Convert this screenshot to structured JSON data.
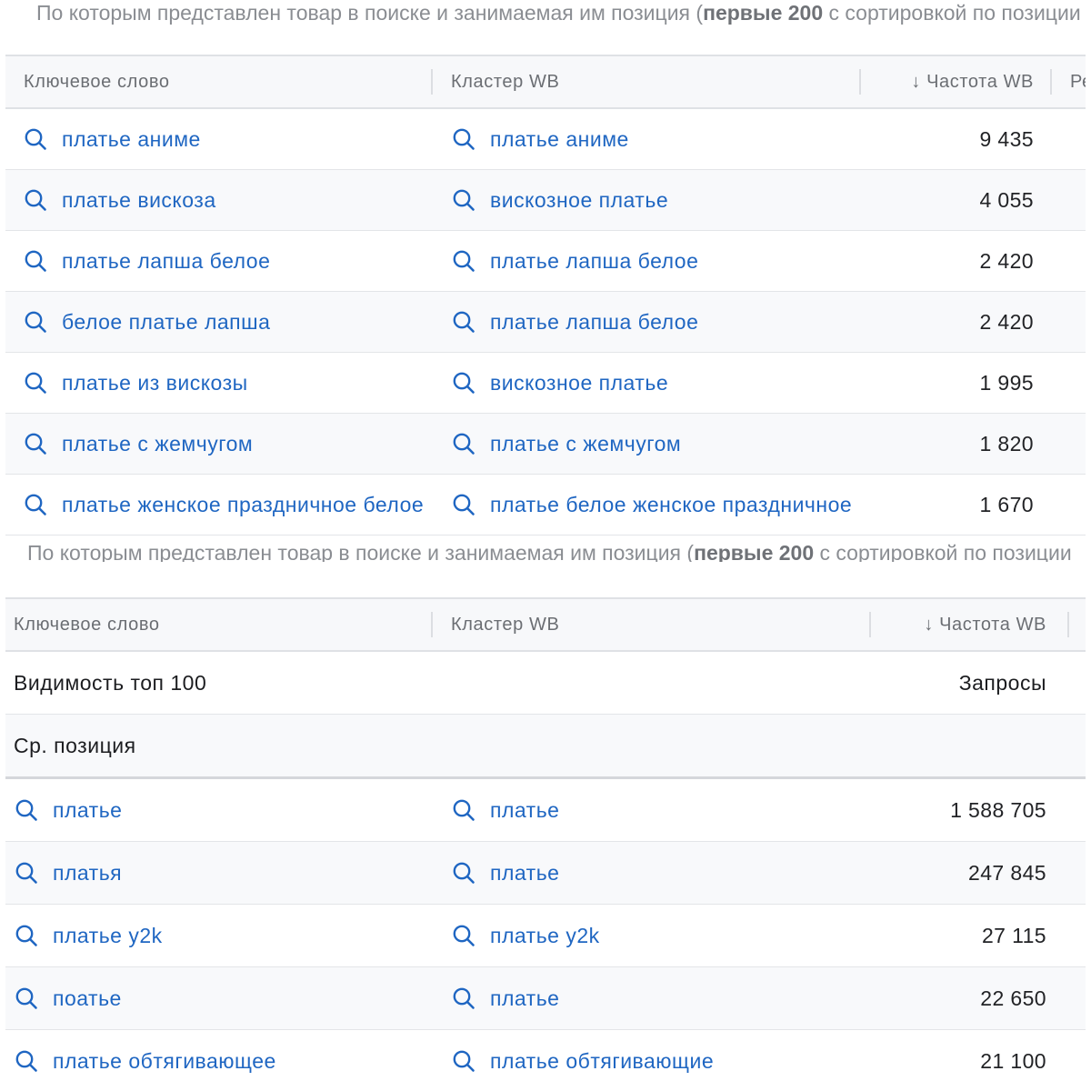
{
  "caption": {
    "prefix": "По которым представлен товар в поиске и занимаемая им позиция (",
    "bold": "первые 200",
    "suffix": " с сортировкой по позиции"
  },
  "table1": {
    "headers": {
      "keyword": "Ключевое слово",
      "cluster": "Кластер WB",
      "frequency": "↓ Частота WB",
      "next": "Ре"
    },
    "rows": [
      {
        "keyword": "платье аниме",
        "cluster": "платье аниме",
        "frequency": "9 435"
      },
      {
        "keyword": "платье вискоза",
        "cluster": "вискозное платье",
        "frequency": "4 055"
      },
      {
        "keyword": "платье лапша белое",
        "cluster": "платье лапша белое",
        "frequency": "2 420"
      },
      {
        "keyword": "белое платье лапша",
        "cluster": "платье лапша белое",
        "frequency": "2 420"
      },
      {
        "keyword": "платье из вискозы",
        "cluster": "вискозное платье",
        "frequency": "1 995"
      },
      {
        "keyword": "платье с жемчугом",
        "cluster": "платье с жемчугом",
        "frequency": "1 820"
      },
      {
        "keyword": "платье женское праздничное белое",
        "cluster": "платье белое женское праздничное",
        "frequency": "1 670"
      }
    ]
  },
  "table2": {
    "headers": {
      "keyword": "Ключевое слово",
      "cluster": "Кластер WB",
      "frequency": "↓ Частота WB"
    },
    "summary": {
      "visibility_label": "Видимость топ 100",
      "requests_label": "Запросы",
      "avg_position_label": "Ср. позиция"
    },
    "rows": [
      {
        "keyword": "платье",
        "cluster": "платье",
        "frequency": "1 588 705"
      },
      {
        "keyword": "платья",
        "cluster": "платье",
        "frequency": "247 845"
      },
      {
        "keyword": "платье y2k",
        "cluster": "платье y2k",
        "frequency": "27 115"
      },
      {
        "keyword": "поатье",
        "cluster": "платье",
        "frequency": "22 650"
      },
      {
        "keyword": "платье обтягивающее",
        "cluster": "платье обтягивающие",
        "frequency": "21 100"
      }
    ]
  },
  "colors": {
    "link": "#1f66c2",
    "header_bg": "#f7f8fa",
    "border": "#dfe1e5"
  }
}
